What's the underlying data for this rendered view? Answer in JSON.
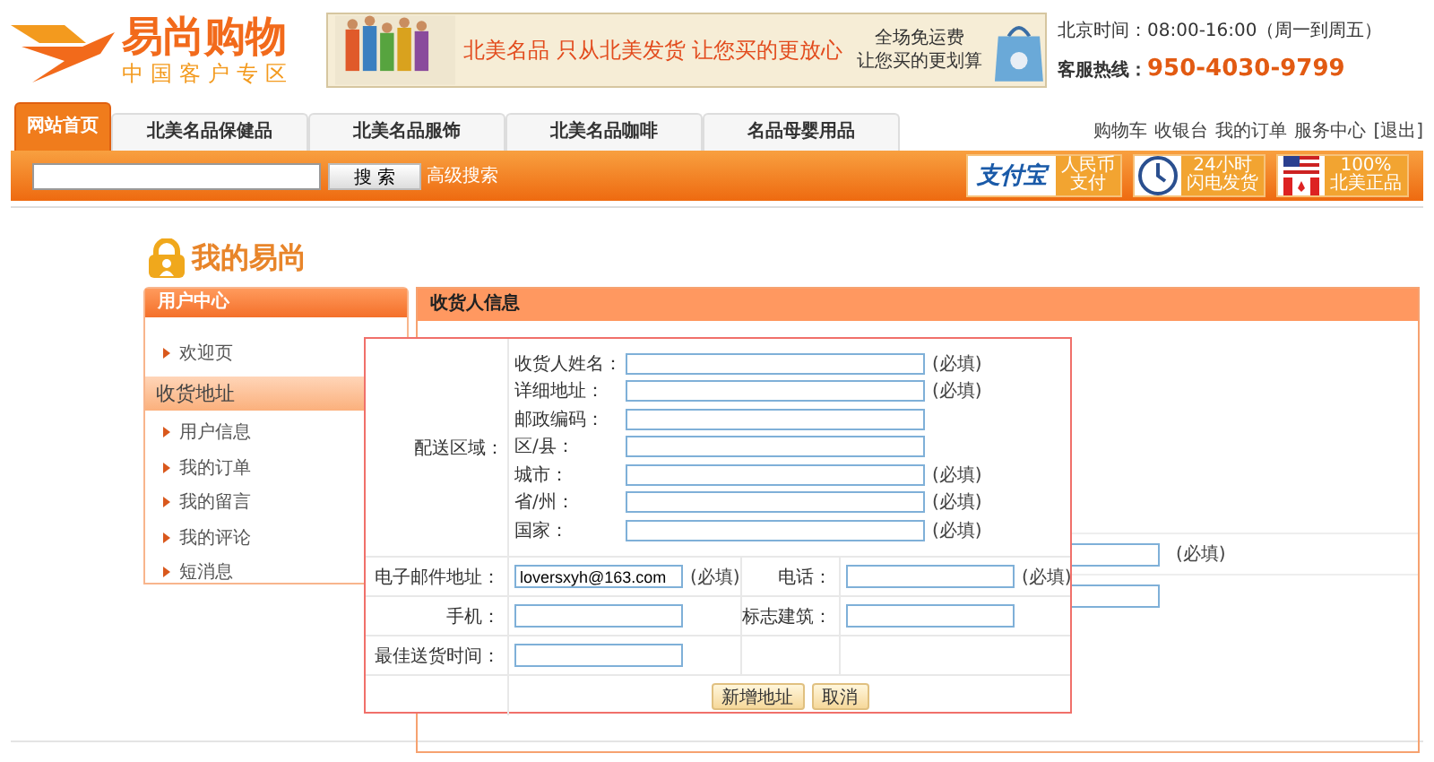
{
  "header": {
    "logo_title": "易尚购物",
    "logo_subtitle": "中国客户专区",
    "banner": {
      "headline": "北美名品 只从北美发货 让您买的更放心",
      "offer": [
        "全场免运费",
        "让您买的更划算"
      ]
    },
    "hours": "北京时间：08:00-16:00（周一到周五）",
    "hotline_label": "客服热线：",
    "hotline": "950-4030-9799"
  },
  "nav": {
    "tabs": [
      {
        "label": "网站首页",
        "selected": true
      },
      {
        "label": "北美名品保健品",
        "selected": false
      },
      {
        "label": "北美名品服饰",
        "selected": false
      },
      {
        "label": "北美名品咖啡",
        "selected": false
      },
      {
        "label": "名品母婴用品",
        "selected": false
      }
    ],
    "links": [
      "购物车",
      "收银台",
      "我的订单",
      "服务中心",
      "[退出]"
    ]
  },
  "search": {
    "button": "搜 索",
    "advanced": "高级搜索"
  },
  "badges": [
    {
      "kind": "alipay",
      "brand": "支付宝",
      "lines": [
        "人民币",
        "支付"
      ]
    },
    {
      "kind": "clock",
      "lines": [
        "24小时",
        "闪电发货"
      ]
    },
    {
      "kind": "flags",
      "lines": [
        "100%",
        "北美正品"
      ]
    }
  ],
  "page_title": "我的易尚",
  "sidebar": {
    "title": "用户中心",
    "items": [
      {
        "label": "欢迎页",
        "kind": "link"
      },
      {
        "label": "收货地址",
        "kind": "section"
      },
      {
        "label": "用户信息",
        "kind": "link"
      },
      {
        "label": "我的订单",
        "kind": "link"
      },
      {
        "label": "我的留言",
        "kind": "link"
      },
      {
        "label": "我的评论",
        "kind": "link"
      },
      {
        "label": "短消息",
        "kind": "link"
      }
    ]
  },
  "panel": {
    "title": "收货人信息",
    "rows": [
      {
        "required": "(必填)"
      },
      {
        "required": ""
      }
    ]
  },
  "dialog": {
    "region_label": "配送区域：",
    "region_fields": [
      {
        "label": "收货人姓名：",
        "required": "(必填)"
      },
      {
        "label": "详细地址：",
        "required": "(必填)"
      },
      {
        "label": "邮政编码："
      },
      {
        "label": "区/县："
      },
      {
        "label": "城市：",
        "required": "(必填)"
      },
      {
        "label": "省/州：",
        "required": "(必填)"
      },
      {
        "label": "国家：",
        "required": "(必填)"
      }
    ],
    "rows": [
      [
        {
          "label": "电子邮件地址：",
          "value": "loversxyh@163.com",
          "required": "(必填)"
        },
        {
          "label": "电话：",
          "required": "(必填)"
        }
      ],
      [
        {
          "label": "手机："
        },
        {
          "label": "标志建筑："
        }
      ],
      [
        {
          "label": "最佳送货时间："
        },
        null
      ]
    ],
    "buttons": [
      "新增地址",
      "取消"
    ]
  }
}
